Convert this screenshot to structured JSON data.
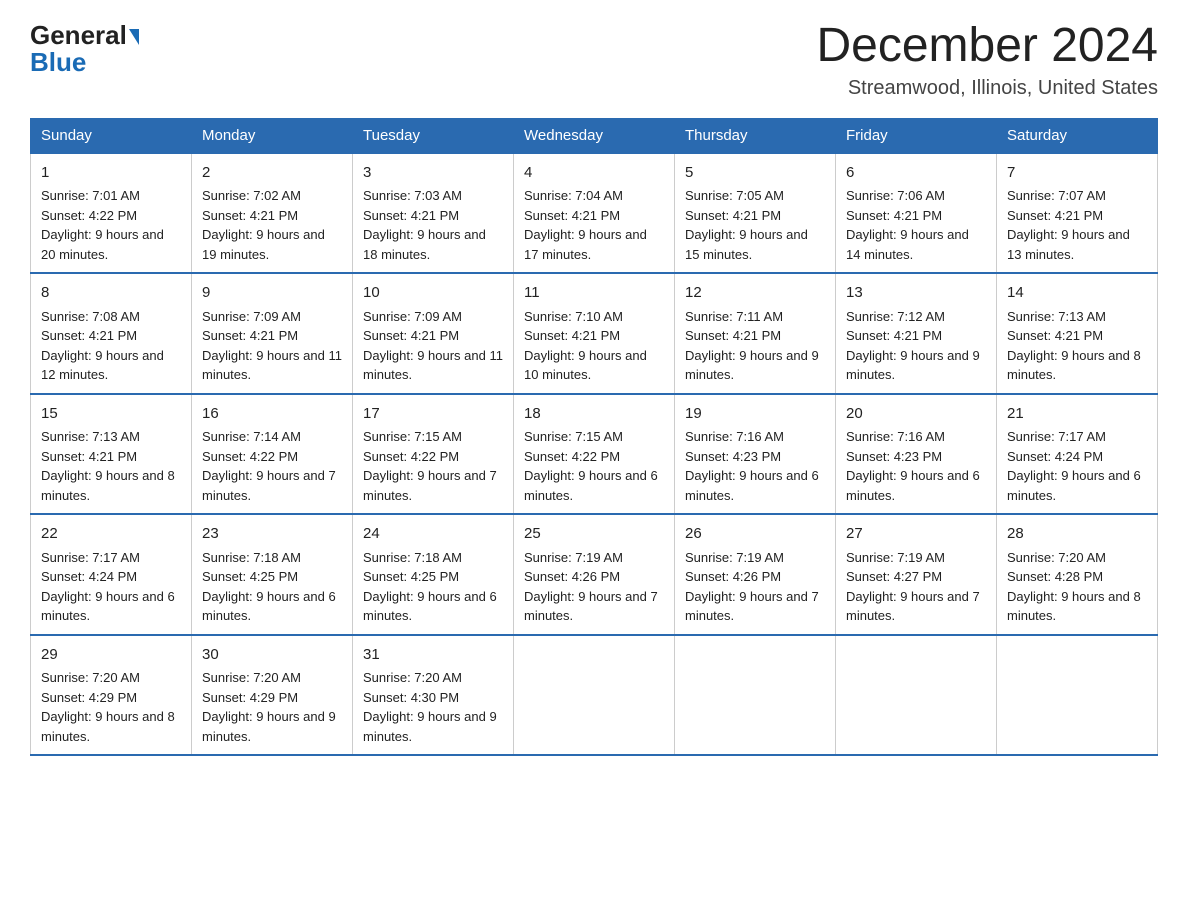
{
  "header": {
    "logo_general": "General",
    "logo_blue": "Blue",
    "month_title": "December 2024",
    "location": "Streamwood, Illinois, United States"
  },
  "days_of_week": [
    "Sunday",
    "Monday",
    "Tuesday",
    "Wednesday",
    "Thursday",
    "Friday",
    "Saturday"
  ],
  "weeks": [
    [
      {
        "day": "1",
        "sunrise": "Sunrise: 7:01 AM",
        "sunset": "Sunset: 4:22 PM",
        "daylight": "Daylight: 9 hours and 20 minutes."
      },
      {
        "day": "2",
        "sunrise": "Sunrise: 7:02 AM",
        "sunset": "Sunset: 4:21 PM",
        "daylight": "Daylight: 9 hours and 19 minutes."
      },
      {
        "day": "3",
        "sunrise": "Sunrise: 7:03 AM",
        "sunset": "Sunset: 4:21 PM",
        "daylight": "Daylight: 9 hours and 18 minutes."
      },
      {
        "day": "4",
        "sunrise": "Sunrise: 7:04 AM",
        "sunset": "Sunset: 4:21 PM",
        "daylight": "Daylight: 9 hours and 17 minutes."
      },
      {
        "day": "5",
        "sunrise": "Sunrise: 7:05 AM",
        "sunset": "Sunset: 4:21 PM",
        "daylight": "Daylight: 9 hours and 15 minutes."
      },
      {
        "day": "6",
        "sunrise": "Sunrise: 7:06 AM",
        "sunset": "Sunset: 4:21 PM",
        "daylight": "Daylight: 9 hours and 14 minutes."
      },
      {
        "day": "7",
        "sunrise": "Sunrise: 7:07 AM",
        "sunset": "Sunset: 4:21 PM",
        "daylight": "Daylight: 9 hours and 13 minutes."
      }
    ],
    [
      {
        "day": "8",
        "sunrise": "Sunrise: 7:08 AM",
        "sunset": "Sunset: 4:21 PM",
        "daylight": "Daylight: 9 hours and 12 minutes."
      },
      {
        "day": "9",
        "sunrise": "Sunrise: 7:09 AM",
        "sunset": "Sunset: 4:21 PM",
        "daylight": "Daylight: 9 hours and 11 minutes."
      },
      {
        "day": "10",
        "sunrise": "Sunrise: 7:09 AM",
        "sunset": "Sunset: 4:21 PM",
        "daylight": "Daylight: 9 hours and 11 minutes."
      },
      {
        "day": "11",
        "sunrise": "Sunrise: 7:10 AM",
        "sunset": "Sunset: 4:21 PM",
        "daylight": "Daylight: 9 hours and 10 minutes."
      },
      {
        "day": "12",
        "sunrise": "Sunrise: 7:11 AM",
        "sunset": "Sunset: 4:21 PM",
        "daylight": "Daylight: 9 hours and 9 minutes."
      },
      {
        "day": "13",
        "sunrise": "Sunrise: 7:12 AM",
        "sunset": "Sunset: 4:21 PM",
        "daylight": "Daylight: 9 hours and 9 minutes."
      },
      {
        "day": "14",
        "sunrise": "Sunrise: 7:13 AM",
        "sunset": "Sunset: 4:21 PM",
        "daylight": "Daylight: 9 hours and 8 minutes."
      }
    ],
    [
      {
        "day": "15",
        "sunrise": "Sunrise: 7:13 AM",
        "sunset": "Sunset: 4:21 PM",
        "daylight": "Daylight: 9 hours and 8 minutes."
      },
      {
        "day": "16",
        "sunrise": "Sunrise: 7:14 AM",
        "sunset": "Sunset: 4:22 PM",
        "daylight": "Daylight: 9 hours and 7 minutes."
      },
      {
        "day": "17",
        "sunrise": "Sunrise: 7:15 AM",
        "sunset": "Sunset: 4:22 PM",
        "daylight": "Daylight: 9 hours and 7 minutes."
      },
      {
        "day": "18",
        "sunrise": "Sunrise: 7:15 AM",
        "sunset": "Sunset: 4:22 PM",
        "daylight": "Daylight: 9 hours and 6 minutes."
      },
      {
        "day": "19",
        "sunrise": "Sunrise: 7:16 AM",
        "sunset": "Sunset: 4:23 PM",
        "daylight": "Daylight: 9 hours and 6 minutes."
      },
      {
        "day": "20",
        "sunrise": "Sunrise: 7:16 AM",
        "sunset": "Sunset: 4:23 PM",
        "daylight": "Daylight: 9 hours and 6 minutes."
      },
      {
        "day": "21",
        "sunrise": "Sunrise: 7:17 AM",
        "sunset": "Sunset: 4:24 PM",
        "daylight": "Daylight: 9 hours and 6 minutes."
      }
    ],
    [
      {
        "day": "22",
        "sunrise": "Sunrise: 7:17 AM",
        "sunset": "Sunset: 4:24 PM",
        "daylight": "Daylight: 9 hours and 6 minutes."
      },
      {
        "day": "23",
        "sunrise": "Sunrise: 7:18 AM",
        "sunset": "Sunset: 4:25 PM",
        "daylight": "Daylight: 9 hours and 6 minutes."
      },
      {
        "day": "24",
        "sunrise": "Sunrise: 7:18 AM",
        "sunset": "Sunset: 4:25 PM",
        "daylight": "Daylight: 9 hours and 6 minutes."
      },
      {
        "day": "25",
        "sunrise": "Sunrise: 7:19 AM",
        "sunset": "Sunset: 4:26 PM",
        "daylight": "Daylight: 9 hours and 7 minutes."
      },
      {
        "day": "26",
        "sunrise": "Sunrise: 7:19 AM",
        "sunset": "Sunset: 4:26 PM",
        "daylight": "Daylight: 9 hours and 7 minutes."
      },
      {
        "day": "27",
        "sunrise": "Sunrise: 7:19 AM",
        "sunset": "Sunset: 4:27 PM",
        "daylight": "Daylight: 9 hours and 7 minutes."
      },
      {
        "day": "28",
        "sunrise": "Sunrise: 7:20 AM",
        "sunset": "Sunset: 4:28 PM",
        "daylight": "Daylight: 9 hours and 8 minutes."
      }
    ],
    [
      {
        "day": "29",
        "sunrise": "Sunrise: 7:20 AM",
        "sunset": "Sunset: 4:29 PM",
        "daylight": "Daylight: 9 hours and 8 minutes."
      },
      {
        "day": "30",
        "sunrise": "Sunrise: 7:20 AM",
        "sunset": "Sunset: 4:29 PM",
        "daylight": "Daylight: 9 hours and 9 minutes."
      },
      {
        "day": "31",
        "sunrise": "Sunrise: 7:20 AM",
        "sunset": "Sunset: 4:30 PM",
        "daylight": "Daylight: 9 hours and 9 minutes."
      },
      null,
      null,
      null,
      null
    ]
  ]
}
